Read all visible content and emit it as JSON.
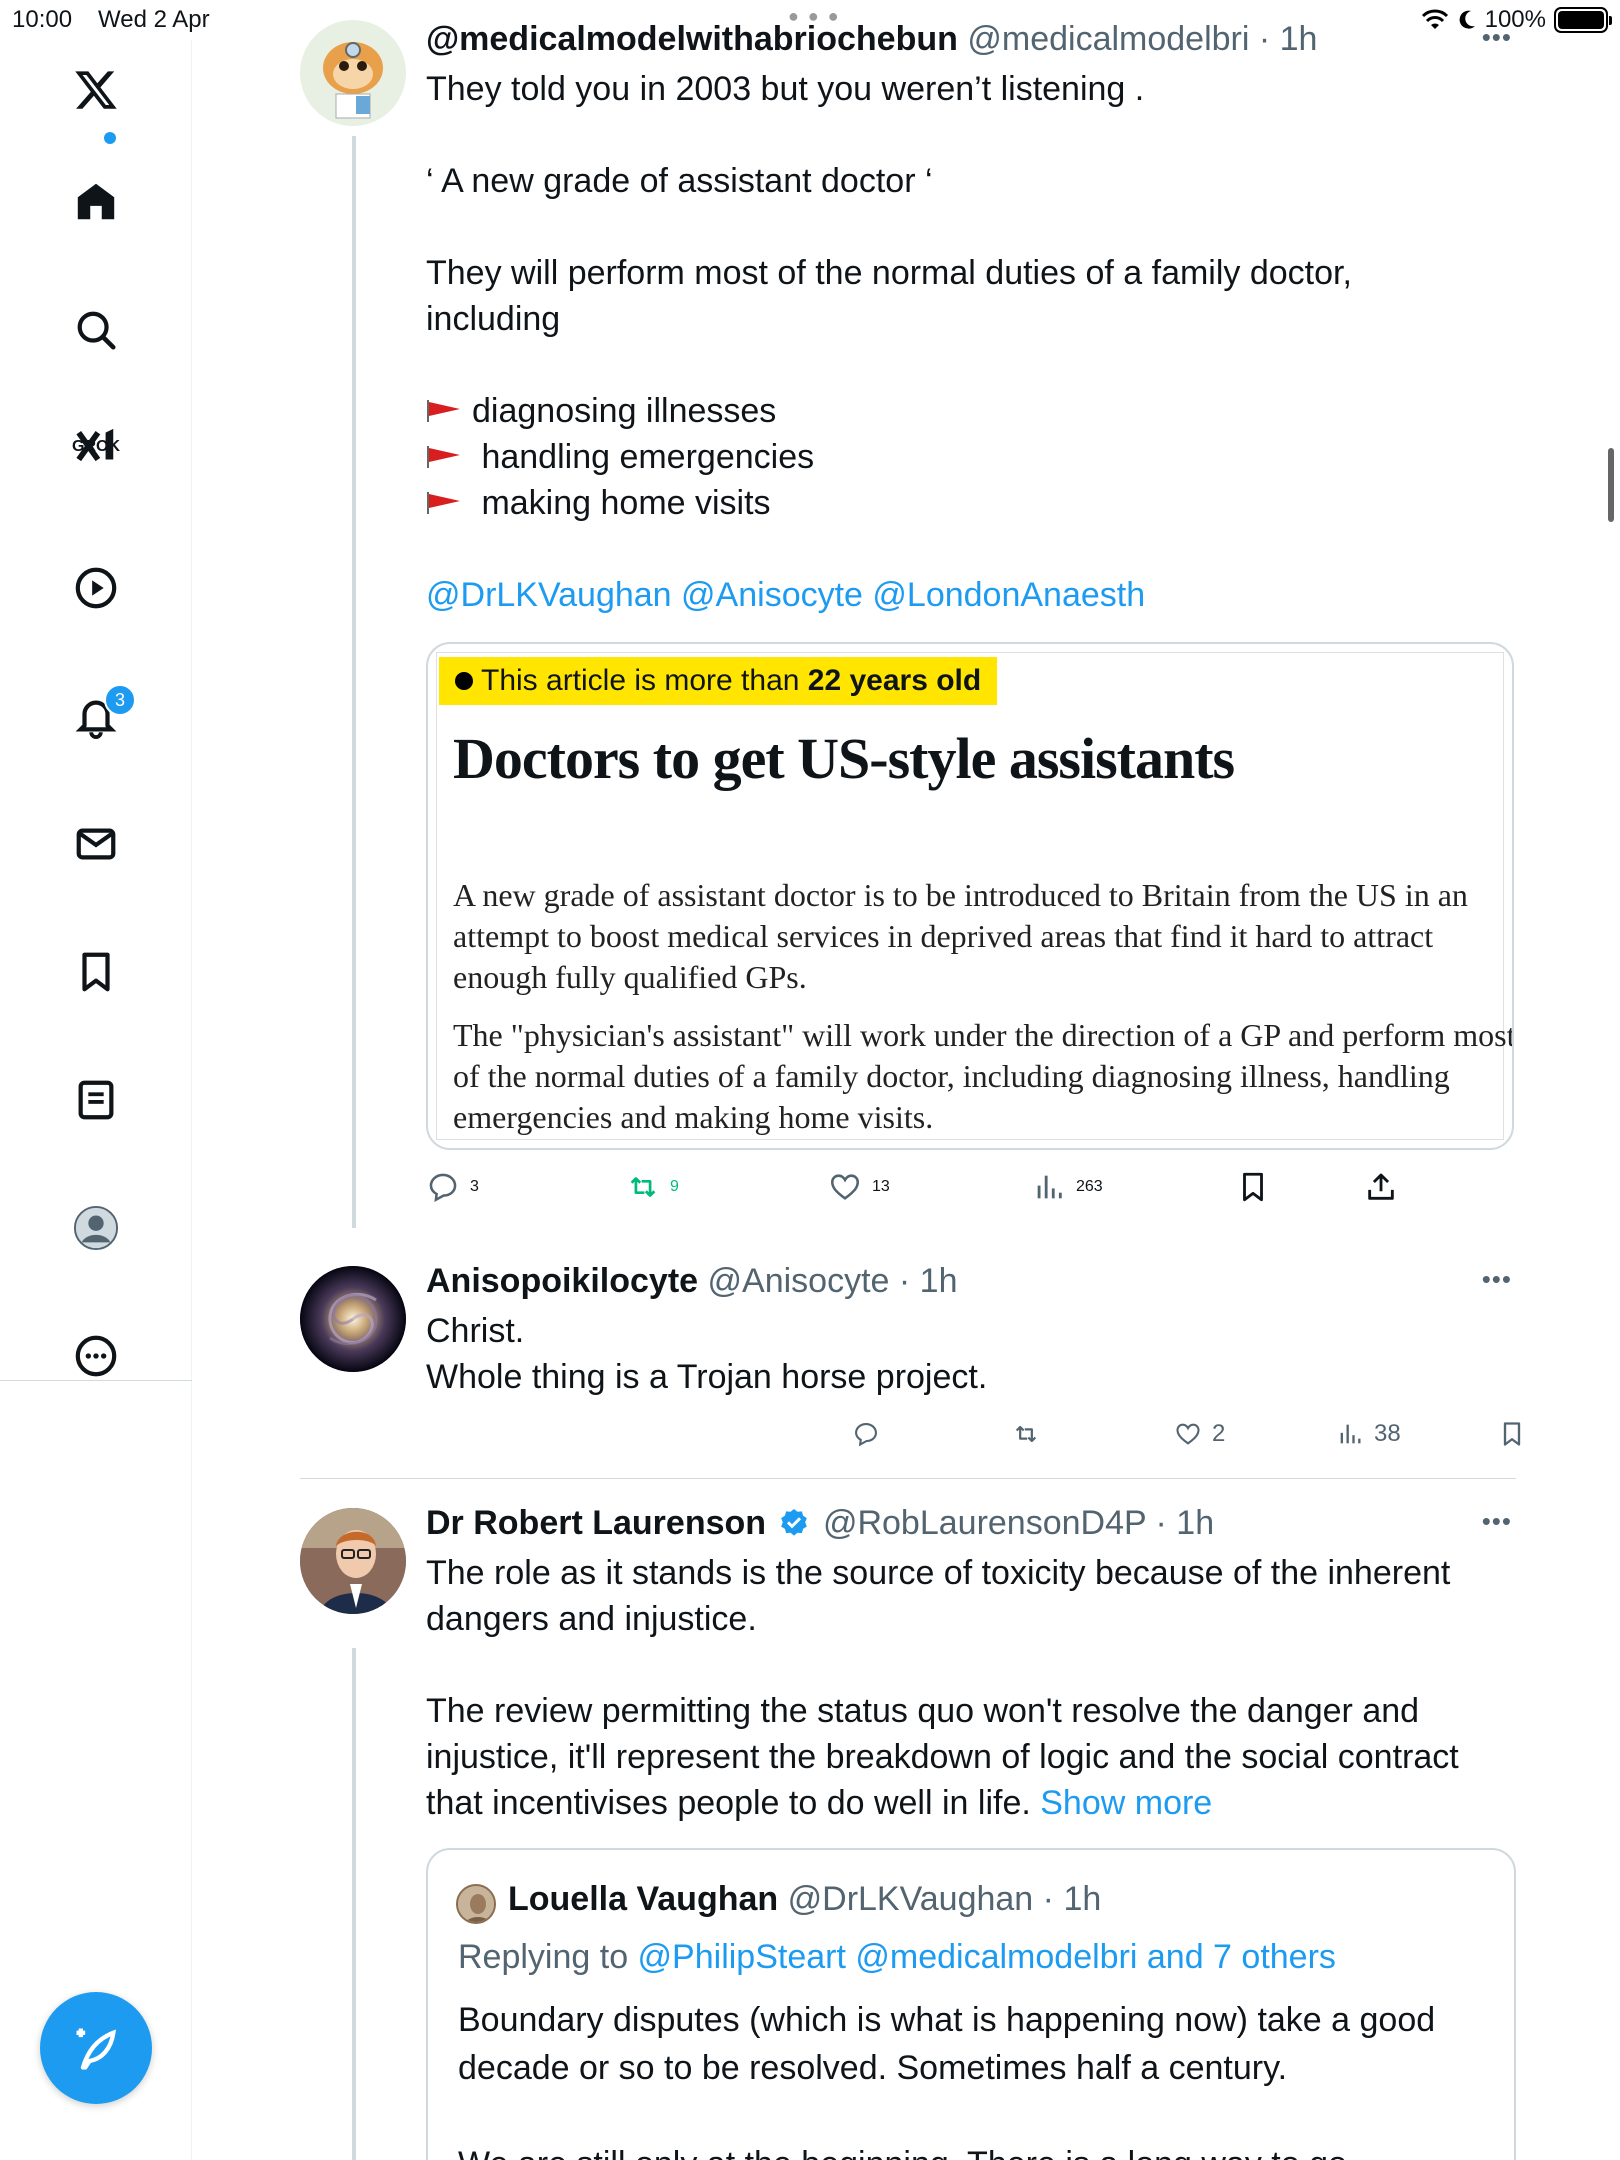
{
  "status_bar": {
    "time": "10:00",
    "date": "Wed 2 Apr",
    "battery": "100%"
  },
  "sidebar": {
    "grok_label": "GROK",
    "notifications_count": "3",
    "accent": "#1d9bf0"
  },
  "posts": [
    {
      "name": "@medicalmodelwithabriochebun",
      "handle": "@medicalmodelbri",
      "time": "· 1h",
      "lines": [
        "They told you in 2003 but you weren’t listening .",
        "",
        "‘ A new grade of assistant doctor ‘",
        "",
        "They  will perform most of the normal duties of a family doctor,",
        "including",
        ""
      ],
      "flags": [
        "diagnosing illnesses",
        " handling emergencies",
        " making home visits"
      ],
      "mentions": "@DrLKVaughan @Anisocyte @LondonAnaesth",
      "card": {
        "banner_prefix": "This article is more than ",
        "banner_bold": "22 years old",
        "headline": "Doctors to get US-style assistants",
        "para1": "A new grade of assistant doctor is to be introduced to Britain from the US in an attempt to boost medical services in deprived areas that find it hard to attract enough fully qualified GPs.",
        "para2": "The \"physician's assistant\" will work under the direction of a GP and perform most of the normal duties of a family doctor, including diagnosing illness, handling emergencies and making home visits."
      },
      "replies": "3",
      "reposts": "9",
      "likes": "13",
      "views": "263"
    },
    {
      "name": "Anisopoikilocyte",
      "handle": "@Anisocyte",
      "time": "· 1h",
      "lines": [
        "Christ.",
        "Whole thing is a Trojan horse project."
      ],
      "replies": "",
      "reposts": "",
      "likes": "2",
      "views": "38"
    },
    {
      "name": "Dr Robert Laurenson",
      "handle": "@RobLaurensonD4P",
      "time": "· 1h",
      "lines": [
        "The role as it stands is the source of toxicity because of the inherent",
        "dangers and injustice.",
        "",
        "The review permitting the status quo won't resolve the danger and",
        "injustice, it'll represent the breakdown of logic and the social contract"
      ],
      "last_line": "that incentivises people to do well in life. ",
      "show_more": "Show more",
      "quote": {
        "name": "Louella Vaughan",
        "handle": "@DrLKVaughan",
        "time": "· 1h",
        "replying_prefix": "Replying to ",
        "replying_to": "@PhilipSteart @medicalmodelbri and 7 others",
        "lines": [
          "Boundary disputes (which is what is happening now) take a good",
          "decade or so to be resolved. Sometimes half a century.",
          "",
          "We are still only at the beginning. There is a long way to go."
        ]
      }
    }
  ]
}
